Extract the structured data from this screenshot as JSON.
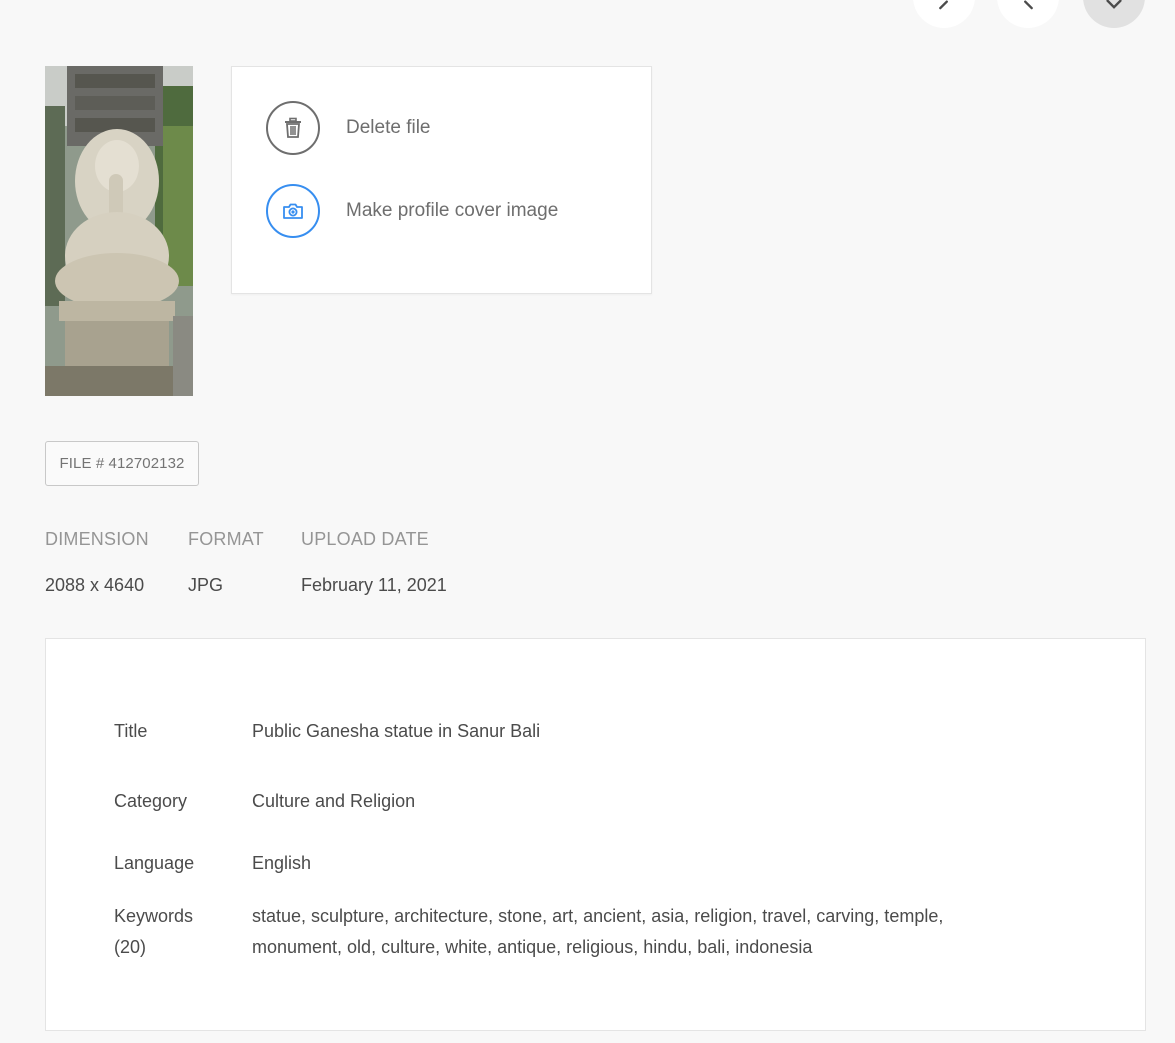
{
  "actions": {
    "delete_label": "Delete file",
    "cover_label": "Make profile cover image"
  },
  "file": {
    "tag": "FILE # 412702132"
  },
  "meta": {
    "dimension_label": "DIMENSION",
    "format_label": "FORMAT",
    "upload_label": "UPLOAD DATE",
    "dimension_value": "2088 x 4640",
    "format_value": "JPG",
    "upload_value": "February 11, 2021"
  },
  "details": {
    "title_label": "Title",
    "title_value": "Public Ganesha statue in Sanur Bali",
    "category_label": "Category",
    "category_value": "Culture and Religion",
    "language_label": "Language",
    "language_value": "English",
    "keywords_label": "Keywords",
    "keywords_count": "(20)",
    "keywords_value": "statue, sculpture, architecture, stone, art, ancient, asia, religion, travel, carving, temple, monument, old, culture, white, antique, religious, hindu, bali, indonesia"
  },
  "colors": {
    "accent": "#378ef0",
    "background": "#f8f8f8",
    "card": "#ffffff",
    "text": "#4b4b4b",
    "muted": "#959595"
  },
  "icons": {
    "prev": "chevron-left-icon",
    "next": "chevron-right-icon",
    "close": "close-icon",
    "delete": "trash-icon",
    "cover": "camera-icon"
  }
}
